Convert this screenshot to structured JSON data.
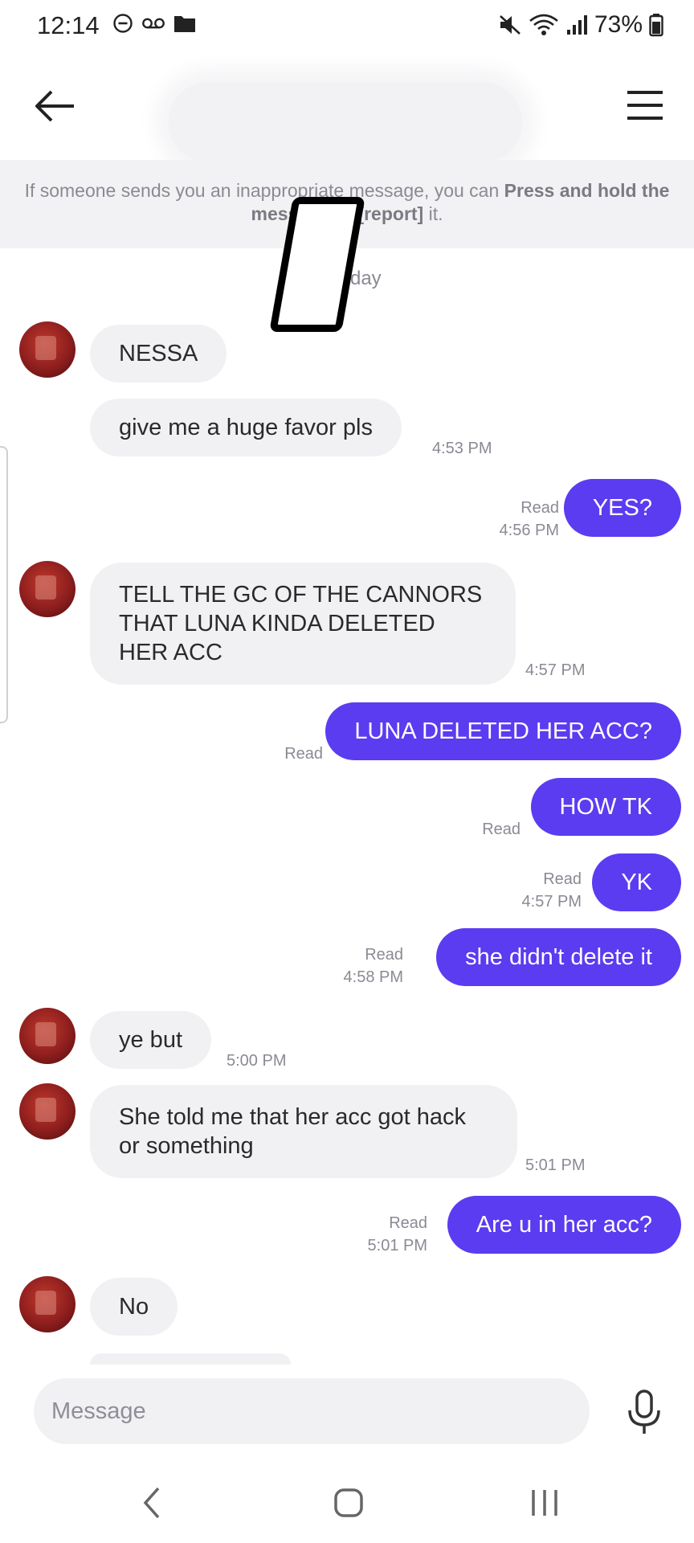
{
  "status_bar": {
    "time": "12:14",
    "battery": "73%"
  },
  "header": {
    "back_icon": "arrow-left-icon",
    "menu_icon": "hamburger-menu-icon"
  },
  "notice": {
    "text_before": "If someone sends you an inappropriate message, you can ",
    "bold_text": "Press and hold the message to [report]",
    "text_after": " it."
  },
  "day_label": "Monday",
  "messages": [
    {
      "side": "in",
      "text": "NESSA"
    },
    {
      "side": "in",
      "text": "give me a huge favor pls",
      "time": "4:53 PM"
    },
    {
      "side": "out",
      "text": "YES?",
      "read": "Read",
      "time": "4:56 PM"
    },
    {
      "side": "in",
      "text": "TELL THE GC OF THE CANNORS THAT LUNA KINDA DELETED HER ACC",
      "time": "4:57 PM"
    },
    {
      "side": "out",
      "text": "LUNA DELETED HER ACC?",
      "read": "Read"
    },
    {
      "side": "out",
      "text": "HOW TK",
      "read": "Read"
    },
    {
      "side": "out",
      "text": "YK",
      "read": "Read",
      "time": "4:57 PM"
    },
    {
      "side": "out",
      "text": "she didn't delete it",
      "read": "Read",
      "time": "4:58 PM"
    },
    {
      "side": "in",
      "text": "ye but",
      "time": "5:00 PM"
    },
    {
      "side": "in",
      "text": "She told me that her acc got hack or something",
      "time": "5:01 PM"
    },
    {
      "side": "out",
      "text": "Are u in her acc?",
      "read": "Read",
      "time": "5:01 PM"
    },
    {
      "side": "in",
      "text": "No"
    }
  ],
  "input": {
    "placeholder": "Message",
    "mic_icon": "microphone-icon"
  },
  "nav": {
    "back_icon": "nav-back-icon",
    "home_icon": "nav-home-icon",
    "recents_icon": "nav-recents-icon"
  }
}
